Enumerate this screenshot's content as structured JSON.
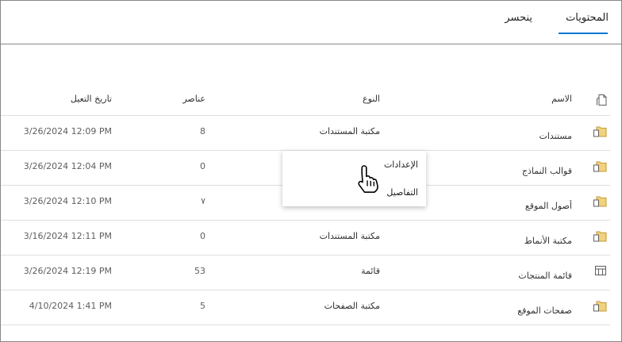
{
  "tabs": {
    "contents": "المحتويات",
    "recycle_bin": "ينحسر"
  },
  "table": {
    "headers": {
      "name": "الاسم",
      "type": "النوع",
      "items": "عناصر",
      "modified": "تاريخ التعيل"
    },
    "rows": [
      {
        "name": "مستندات",
        "type": "مكتبة المستندات",
        "items": "8",
        "modified": "3/26/2024 12:09 PM",
        "icon": "folder-doc-icon"
      },
      {
        "name": "قوالب النماذج",
        "type": "",
        "items": "0",
        "modified": "3/26/2024 12:04 PM",
        "icon": "folder-doc-icon"
      },
      {
        "name": "أصول الموقع",
        "type": "",
        "items": "٧",
        "modified": "3/26/2024 12:10 PM",
        "icon": "folder-doc-icon"
      },
      {
        "name": "مكتبة الأنماط",
        "type": "مكتبة المستندات",
        "items": "0",
        "modified": "3/16/2024 12:11 PM",
        "icon": "folder-doc-icon"
      },
      {
        "name": "قائمة المنتجات",
        "type": "قائمة",
        "items": "53",
        "modified": "3/26/2024 12:19 PM",
        "icon": "list-icon"
      },
      {
        "name": "صفحات الموقع",
        "type": "مكتبة الصفحات",
        "items": "5",
        "modified": "4/10/2024 1:41 PM",
        "icon": "folder-doc-icon"
      }
    ]
  },
  "context_menu": {
    "settings": "الإعدادات",
    "details": "التفاصيل"
  },
  "colors": {
    "accent": "#0078d4",
    "folder": "#dcb35c"
  }
}
